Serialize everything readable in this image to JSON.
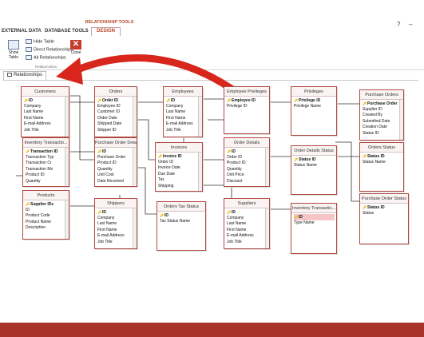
{
  "window": {
    "help_label": "?",
    "minimize_label": "–"
  },
  "ribbon": {
    "context_group": "RELATIONSHIP TOOLS",
    "tabs": [
      "EXTERNAL DATA",
      "DATABASE TOOLS",
      "DESIGN"
    ],
    "active_tab": "DESIGN",
    "buttons": {
      "show_table": "Show Table",
      "hide_table": "Hide Table",
      "direct_relationships": "Direct Relationships",
      "all_relationships": "All Relationships",
      "close": "Close"
    },
    "group_label": "Relationships"
  },
  "document_tab": {
    "label": "Relationships"
  },
  "tables": [
    {
      "name": "Customers",
      "fields": [
        "ID",
        "Company",
        "Last Name",
        "First Name",
        "E-mail Address",
        "Job Title"
      ],
      "key": 0,
      "highlight": -1
    },
    {
      "name": "Orders",
      "fields": [
        "Order ID",
        "Employee ID",
        "Customer ID",
        "Order Date",
        "Shipped Date",
        "Shipper ID"
      ],
      "key": 0,
      "highlight": -1
    },
    {
      "name": "Employees",
      "fields": [
        "ID",
        "Company",
        "Last Name",
        "First Name",
        "E-mail Address",
        "Job Title"
      ],
      "key": 0,
      "highlight": -1
    },
    {
      "name": "Employee Privileges",
      "fields": [
        "Employee ID",
        "Privilege ID"
      ],
      "key": 0,
      "highlight": -1
    },
    {
      "name": "Privileges",
      "fields": [
        "Privilege ID",
        "Privilege Name"
      ],
      "key": 0,
      "highlight": -1
    },
    {
      "name": "Purchase Orders",
      "fields": [
        "Purchase Order",
        "Supplier ID",
        "Created By",
        "Submitted Date",
        "Creation Date",
        "Status ID"
      ],
      "key": 0,
      "highlight": -1
    },
    {
      "name": "Inventory Transactio...",
      "fields": [
        "Transaction ID",
        "Transaction Typ",
        "Transaction Cr",
        "Transaction Mo",
        "Product ID",
        "Quantity"
      ],
      "key": 0,
      "highlight": -1
    },
    {
      "name": "Purchase Order Deta...",
      "fields": [
        "ID",
        "Purchase Order",
        "Product ID",
        "Quantity",
        "Unit Cost",
        "Date Received"
      ],
      "key": 0,
      "highlight": -1
    },
    {
      "name": "Invoices",
      "fields": [
        "Invoice ID",
        "Order ID",
        "Invoice Date",
        "Due Date",
        "Tax",
        "Shipping"
      ],
      "key": 0,
      "highlight": -1
    },
    {
      "name": "Order Details",
      "fields": [
        "ID",
        "Order ID",
        "Product ID",
        "Quantity",
        "Unit Price",
        "Discount"
      ],
      "key": 0,
      "highlight": -1
    },
    {
      "name": "Order Details Status",
      "fields": [
        "Status ID",
        "Status Name"
      ],
      "key": 0,
      "highlight": -1
    },
    {
      "name": "Orders Status",
      "fields": [
        "Status ID",
        "Status Name"
      ],
      "key": 0,
      "highlight": -1
    },
    {
      "name": "Products",
      "fields": [
        "Supplier IDs",
        "ID",
        "Product Code",
        "Product Name",
        "Description"
      ],
      "key": 0,
      "highlight": -1
    },
    {
      "name": "Shippers",
      "fields": [
        "ID",
        "Company",
        "Last Name",
        "First Name",
        "E-mail Address",
        "Job Title"
      ],
      "key": 0,
      "highlight": -1
    },
    {
      "name": "Orders Tax Status",
      "fields": [
        "ID",
        "Tax Status Name"
      ],
      "key": 0,
      "highlight": -1
    },
    {
      "name": "Suppliers",
      "fields": [
        "ID",
        "Company",
        "Last Name",
        "First Name",
        "E-mail Address",
        "Job Title"
      ],
      "key": 0,
      "highlight": -1
    },
    {
      "name": "Inventory Transactio...",
      "fields": [
        "ID",
        "Type Name"
      ],
      "key": 0,
      "highlight": 0
    },
    {
      "name": "Purchase Order Status",
      "fields": [
        "Status ID",
        "Status"
      ],
      "key": 0,
      "highlight": -1
    }
  ],
  "colors": {
    "accent": "#b7472a",
    "arrow": "#d9261c",
    "table_border": "#b24a42",
    "bottom_bar": "#a8332a"
  }
}
